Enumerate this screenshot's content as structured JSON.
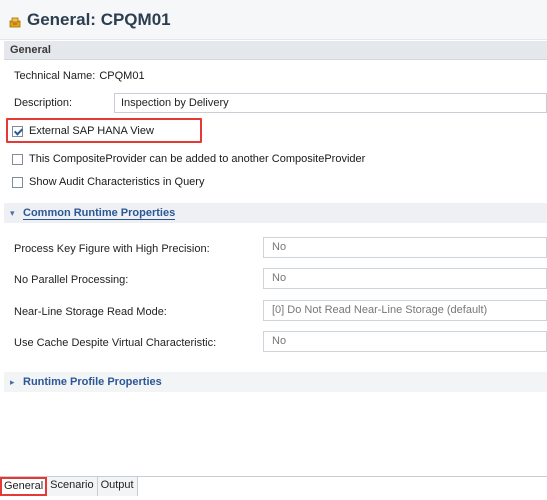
{
  "header": {
    "title": "General: CPQM01",
    "icon": "composite-provider-icon"
  },
  "general_section": {
    "label": "General",
    "technical_name_label": "Technical Name:",
    "technical_name_value": "CPQM01",
    "description_label": "Description:",
    "description_value": "Inspection by Delivery"
  },
  "options": {
    "external_view_label": "External SAP HANA View",
    "external_view_checked": true,
    "composite_label": "This CompositeProvider can be added to another CompositeProvider",
    "composite_checked": false,
    "audit_label": "Show Audit Characteristics in Query",
    "audit_checked": false
  },
  "runtime": {
    "label": "Common Runtime Properties",
    "toggle": "▾",
    "props": [
      {
        "label": "Process Key Figure with High Precision:",
        "value": "No"
      },
      {
        "label": "No Parallel Processing:",
        "value": "No"
      },
      {
        "label": "Near-Line Storage Read Mode:",
        "value": "[0] Do Not Read Near-Line Storage (default)"
      },
      {
        "label": "Use Cache Despite Virtual Characteristic:",
        "value": "No"
      }
    ]
  },
  "profile": {
    "label": "Runtime Profile Properties",
    "toggle": "▸"
  },
  "tabs": [
    {
      "label": "General",
      "active": true
    },
    {
      "label": "Scenario",
      "active": false
    },
    {
      "label": "Output",
      "active": false
    }
  ],
  "colors": {
    "highlight": "#e53935",
    "link": "#2b5797"
  }
}
